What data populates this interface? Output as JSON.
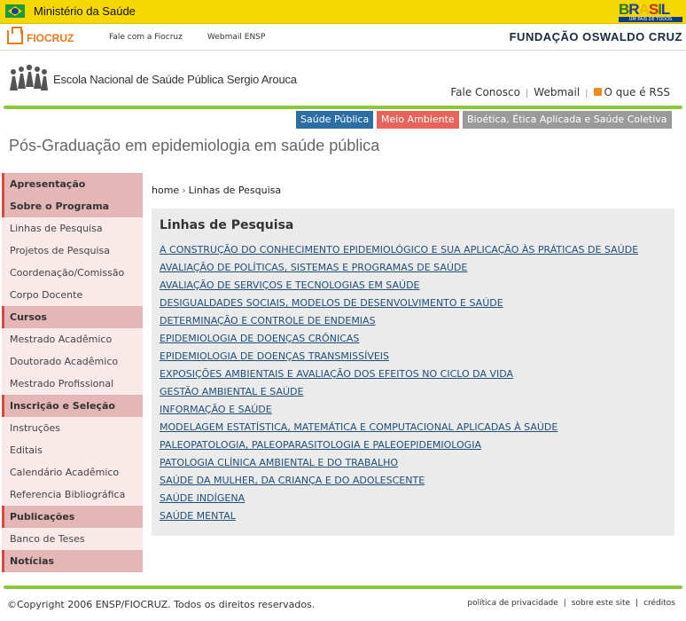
{
  "gov_bar": {
    "title": "Ministério da Saúde",
    "brasil_tagline": "UM PAÍS DE TODOS",
    "brasil_logo_text": "BRASIL"
  },
  "fio_bar": {
    "logo_text": "FIOCRUZ",
    "links": [
      "Fale com a Fiocruz",
      "Webmail ENSP"
    ],
    "foundation_name": "FUNDAÇÃO OSWALDO CRUZ"
  },
  "header": {
    "school_name": "Escola Nacional de Saúde Pública Sergio Arouca",
    "links": {
      "contact": "Fale Conosco",
      "webmail": "Webmail",
      "rss": "O que é RSS"
    }
  },
  "tabs": [
    {
      "label": "Saúde Pública",
      "color": "#2a6ea6"
    },
    {
      "label": "Meio Ambiente",
      "color": "#e8645a"
    },
    {
      "label": "Bioética, Ética Aplicada e Saúde Coletiva",
      "color": "#9a9a9a"
    }
  ],
  "page_heading": "Pós-Graduação em epidemiologia em saúde pública",
  "sidebar": {
    "items": [
      {
        "type": "section",
        "label": "Apresentação"
      },
      {
        "type": "section",
        "label": "Sobre o Programa"
      },
      {
        "type": "link",
        "label": "Linhas de Pesquisa"
      },
      {
        "type": "link",
        "label": "Projetos de Pesquisa"
      },
      {
        "type": "link",
        "label": "Coordenação/Comissão"
      },
      {
        "type": "link",
        "label": "Corpo Docente"
      },
      {
        "type": "section",
        "label": "Cursos"
      },
      {
        "type": "link",
        "label": "Mestrado Acadêmico"
      },
      {
        "type": "link",
        "label": "Doutorado Acadêmico"
      },
      {
        "type": "link",
        "label": "Mestrado Profissional"
      },
      {
        "type": "section",
        "label": "Inscrição e Seleção"
      },
      {
        "type": "link",
        "label": "Instruções"
      },
      {
        "type": "link",
        "label": "Editais"
      },
      {
        "type": "link",
        "label": "Calendário Acadêmico"
      },
      {
        "type": "link",
        "label": "Referencia Bibliográfica"
      },
      {
        "type": "section",
        "label": "Publicações"
      },
      {
        "type": "link",
        "label": "Banco de Teses"
      },
      {
        "type": "section",
        "label": "Notícias"
      }
    ]
  },
  "breadcrumb": {
    "home": "home",
    "current": "Linhas de Pesquisa"
  },
  "content": {
    "title": "Linhas de Pesquisa",
    "research_lines": [
      "A CONSTRUÇÃO DO CONHECIMENTO EPIDEMIOLÓGICO E SUA APLICAÇÃO ÀS PRÁTICAS DE SAÚDE",
      "AVALIAÇÃO DE POLÍTICAS, SISTEMAS E PROGRAMAS DE SAÚDE",
      "AVALIAÇÃO DE SERVIÇOS E TECNOLOGIAS EM SAÚDE",
      "DESIGUALDADES SOCIAIS, MODELOS DE DESENVOLVIMENTO E SAÚDE",
      "DETERMINAÇÃO E CONTROLE DE ENDEMIAS",
      "EPIDEMIOLOGIA DE DOENÇAS CRÔNICAS",
      "EPIDEMIOLOGIA DE DOENÇAS TRANSMISSÍVEIS",
      "EXPOSIÇÕES AMBIENTAIS E AVALIAÇÃO DOS EFEITOS NO CICLO DA VIDA",
      "GESTÃO AMBIENTAL E SAÚDE",
      "INFORMAÇÃO E SAÚDE",
      "MODELAGEM ESTATÍSTICA, MATEMÁTICA E COMPUTACIONAL APLICADAS À SAÚDE",
      "PALEOPATOLOGIA, PALEOPARASITOLOGIA E PALEOEPIDEMIOLOGIA",
      "PATOLOGIA CLÍNICA AMBIENTAL E DO TRABALHO",
      "SAÚDE DA MULHER, DA CRIANÇA E DO ADOLESCENTE",
      "SAÚDE INDÍGENA",
      "SAÚDE MENTAL"
    ]
  },
  "footer": {
    "copyright": "©Copyright 2006 ENSP/FIOCRUZ. Todos os direitos reservados.",
    "links": [
      "política de privacidade",
      "sobre este site",
      "créditos"
    ]
  },
  "colors": {
    "accent_green": "#8cc63f",
    "gov_yellow": "#f5d800",
    "sidebar_section": "#e4b6b6",
    "sidebar_link": "#f9e9e9"
  }
}
